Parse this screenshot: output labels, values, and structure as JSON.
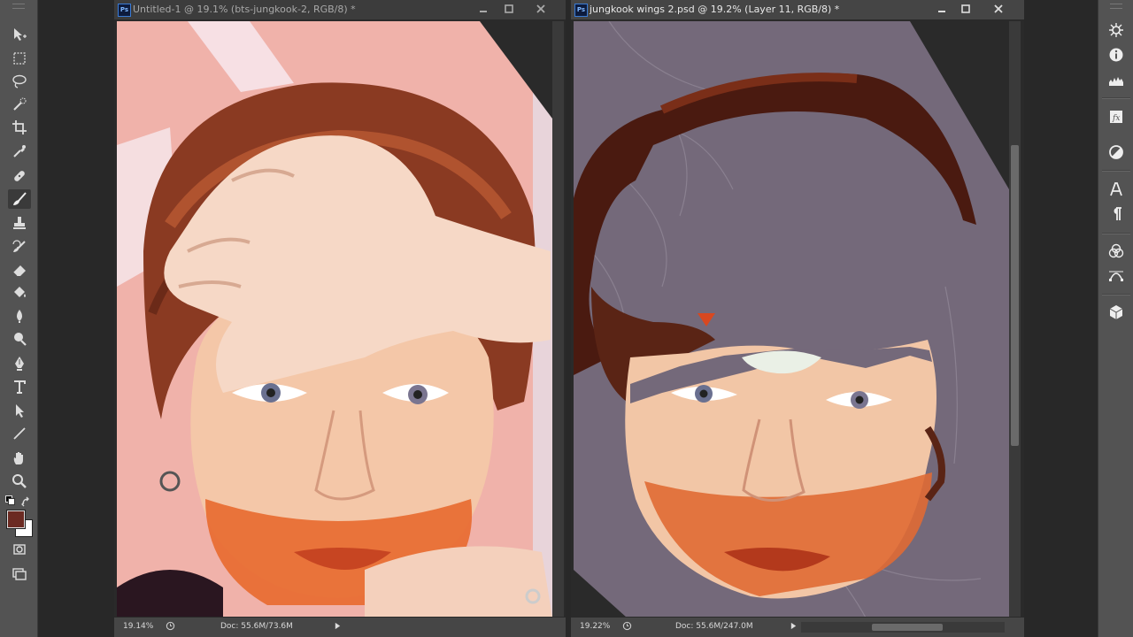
{
  "app": {
    "name": "Photoshop",
    "logo_text": "Ps"
  },
  "documents": [
    {
      "title": "Untitled-1 @ 19.1% (bts-jungkook-2, RGB/8) *",
      "zoom": "19.14%",
      "doc_info": "Doc: 55.6M/73.6M",
      "active": false
    },
    {
      "title": "jungkook wings 2.psd @ 19.2% (Layer 11, RGB/8) *",
      "zoom": "19.22%",
      "doc_info": "Doc: 55.6M/247.0M",
      "active": true
    }
  ],
  "tools": [
    "move-tool-icon",
    "marquee-tool-icon",
    "lasso-tool-icon",
    "quick-select-tool-icon",
    "crop-tool-icon",
    "eyedropper-tool-icon",
    "healing-brush-tool-icon",
    "brush-tool-icon",
    "clone-stamp-tool-icon",
    "history-brush-tool-icon",
    "eraser-tool-icon",
    "paint-bucket-tool-icon",
    "blur-tool-icon",
    "dodge-tool-icon",
    "pen-tool-icon",
    "type-tool-icon",
    "path-selection-tool-icon",
    "line-tool-icon",
    "hand-tool-icon",
    "zoom-tool-icon"
  ],
  "active_tool": "brush-tool-icon",
  "colors": {
    "foreground": "#6b2a22",
    "background": "#ffffff",
    "accent": "#3a7bd5"
  },
  "right_panel_icons": [
    "navigator-icon",
    "info-icon",
    "histogram-icon",
    "styles-icon",
    "adjustments-icon",
    "character-icon",
    "paragraph-icon",
    "channels-icon",
    "paths-icon",
    "3d-icon"
  ]
}
